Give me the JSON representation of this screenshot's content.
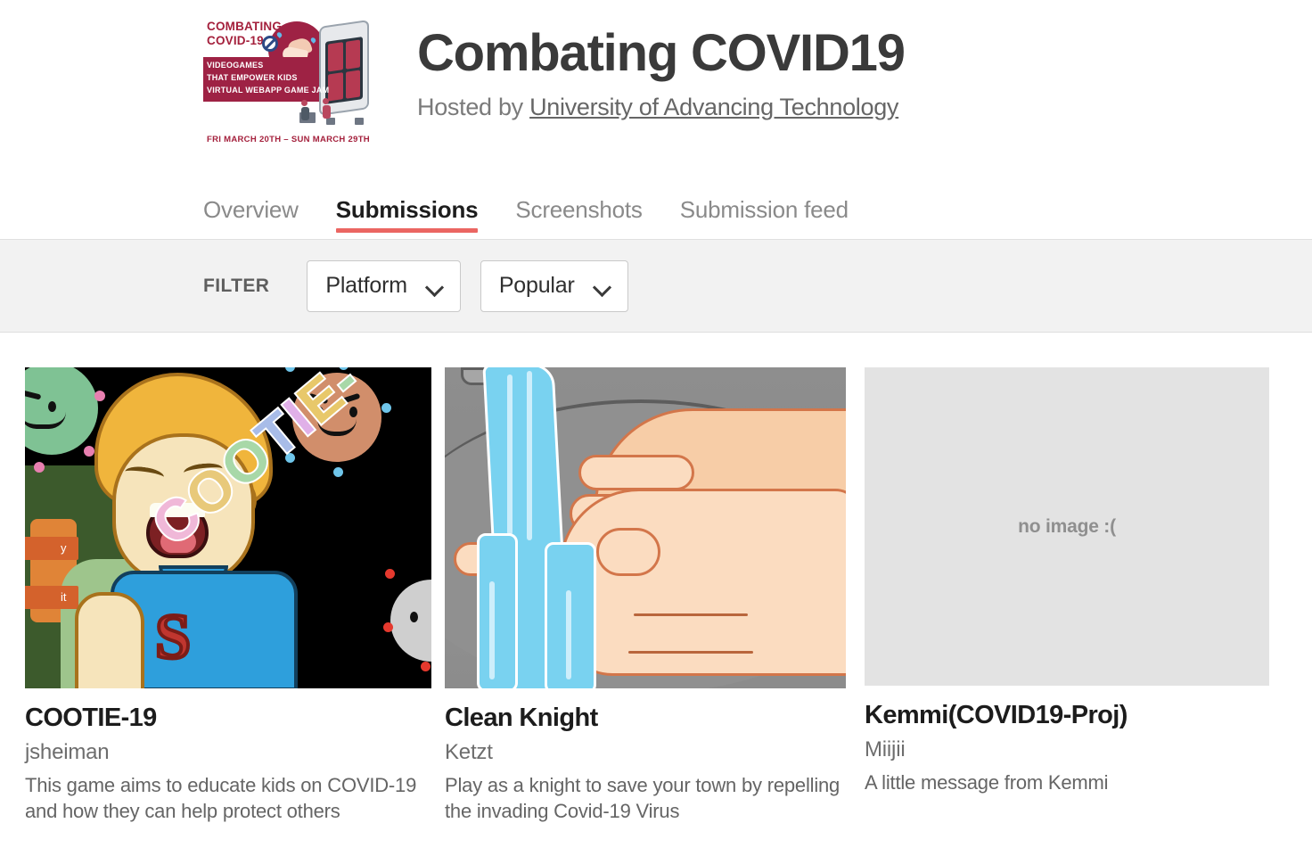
{
  "header": {
    "logo": {
      "title_line1": "Combating",
      "title_line2": "Covid-19:",
      "banner_line1": "Videogames",
      "banner_line2": "That Empower Kids",
      "banner_line3": "Virtual Webapp Game Jam",
      "date_line": "FRI MARCH 20TH – SUN MARCH 29TH",
      "accent_color": "#9e2244"
    },
    "title": "Combating COVID19",
    "hosted_prefix": "Hosted by ",
    "host_name": "University of Advancing Technology",
    "tabs": [
      {
        "label": "Overview",
        "active": false
      },
      {
        "label": "Submissions",
        "active": true
      },
      {
        "label": "Screenshots",
        "active": false
      },
      {
        "label": "Submission feed",
        "active": false
      }
    ],
    "active_tab_color": "#eb6662"
  },
  "filter": {
    "label": "FILTER",
    "platform_value": "Platform",
    "sort_value": "Popular",
    "chevron_icon": "chevron-down-icon"
  },
  "submissions": [
    {
      "title": "COOTIE-19",
      "author": "jsheiman",
      "description": "This game aims to educate kids on COVID-19 and how they can help protect others",
      "thumbnail": "cootie-19-artwork",
      "has_image": true,
      "art_word": "COOTIE-",
      "art_chip1": "y",
      "art_chip2": "it"
    },
    {
      "title": "Clean Knight",
      "author": "Ketzt",
      "description": "Play as a knight to save your town by repelling the invading Covid-19 Virus",
      "thumbnail": "handwashing-artwork",
      "has_image": true
    },
    {
      "title": "Kemmi(COVID19-Proj)",
      "author": "Miijii",
      "description": "A little message from Kemmi",
      "thumbnail": "no-image-placeholder",
      "has_image": false,
      "placeholder_text": "no image :("
    }
  ]
}
